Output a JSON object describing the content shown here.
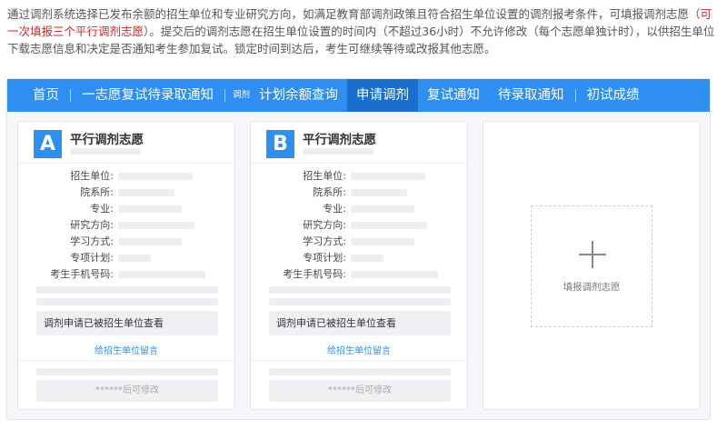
{
  "intro": {
    "part1": "通过调剂系统选择已发布余额的招生单位和专业研究方向，如满足教育部调剂政策且符合招生单位设置的调剂报考条件，可填报调剂志愿（",
    "highlight": "可一次填报三个平行调剂志愿",
    "part2": "）。提交后的调剂志愿在招生单位设置的时间内（不超过36小时）不允许修改（每个志愿单独计时），以供招生单位下载志愿信息和决定是否通知考生参加复试。锁定时间到达后，考生可继续等待或改报其他志愿。"
  },
  "nav": {
    "items": [
      {
        "label": "首页"
      },
      {
        "label": "一志愿复试待录取通知"
      },
      {
        "label": "计划余额查询",
        "prefix": "调剂"
      },
      {
        "label": "申请调剂",
        "active": true
      },
      {
        "label": "复试通知"
      },
      {
        "label": "待录取通知"
      },
      {
        "label": "初试成绩"
      }
    ]
  },
  "cards": [
    {
      "letter": "A",
      "title": "平行调剂志愿",
      "fields": [
        "招生单位:",
        "院系所:",
        "专业:",
        "研究方向:",
        "学习方式:",
        "专项计划:",
        "考生手机号码:"
      ],
      "notice": "调剂申请已被招生单位查看",
      "message_link": "给招生单位留言",
      "edit_text": "******后可修改"
    },
    {
      "letter": "B",
      "title": "平行调剂志愿",
      "fields": [
        "招生单位:",
        "院系所:",
        "专业:",
        "研究方向:",
        "学习方式:",
        "专项计划:",
        "考生手机号码:"
      ],
      "notice": "调剂申请已被招生单位查看",
      "message_link": "给招生单位留言",
      "edit_text": "******后可修改"
    }
  ],
  "add_card": {
    "label": "填报调剂志愿",
    "icon": "plus-icon"
  },
  "colors": {
    "accent": "#2f8ff0",
    "active_nav": "#1a6fce",
    "highlight": "#e02020"
  }
}
